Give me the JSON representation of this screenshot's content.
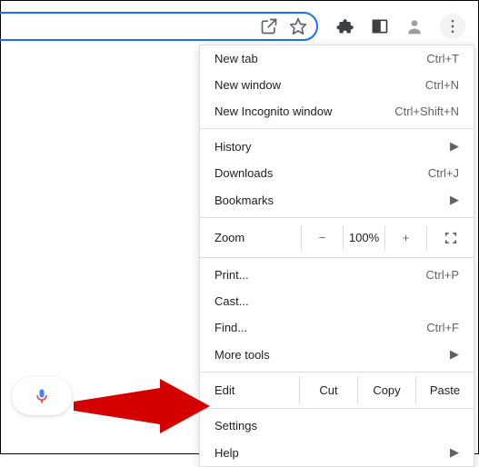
{
  "toolbar": {
    "share_icon": "share-icon",
    "star_icon": "star-icon",
    "extensions_icon": "extensions-icon",
    "sidepanel_icon": "sidepanel-icon",
    "profile_icon": "profile-icon",
    "more_icon": "more-vertical-icon"
  },
  "menu": {
    "new_tab": {
      "label": "New tab",
      "shortcut": "Ctrl+T"
    },
    "new_window": {
      "label": "New window",
      "shortcut": "Ctrl+N"
    },
    "new_incognito": {
      "label": "New Incognito window",
      "shortcut": "Ctrl+Shift+N"
    },
    "history": {
      "label": "History"
    },
    "downloads": {
      "label": "Downloads",
      "shortcut": "Ctrl+J"
    },
    "bookmarks": {
      "label": "Bookmarks"
    },
    "zoom": {
      "label": "Zoom",
      "minus": "−",
      "value": "100%",
      "plus": "+"
    },
    "print": {
      "label": "Print...",
      "shortcut": "Ctrl+P"
    },
    "cast": {
      "label": "Cast..."
    },
    "find": {
      "label": "Find...",
      "shortcut": "Ctrl+F"
    },
    "more_tools": {
      "label": "More tools"
    },
    "edit": {
      "label": "Edit",
      "cut": "Cut",
      "copy": "Copy",
      "paste": "Paste"
    },
    "settings": {
      "label": "Settings"
    },
    "help": {
      "label": "Help"
    }
  },
  "mic": {
    "icon": "mic-icon"
  },
  "submenu_arrow": "▶"
}
